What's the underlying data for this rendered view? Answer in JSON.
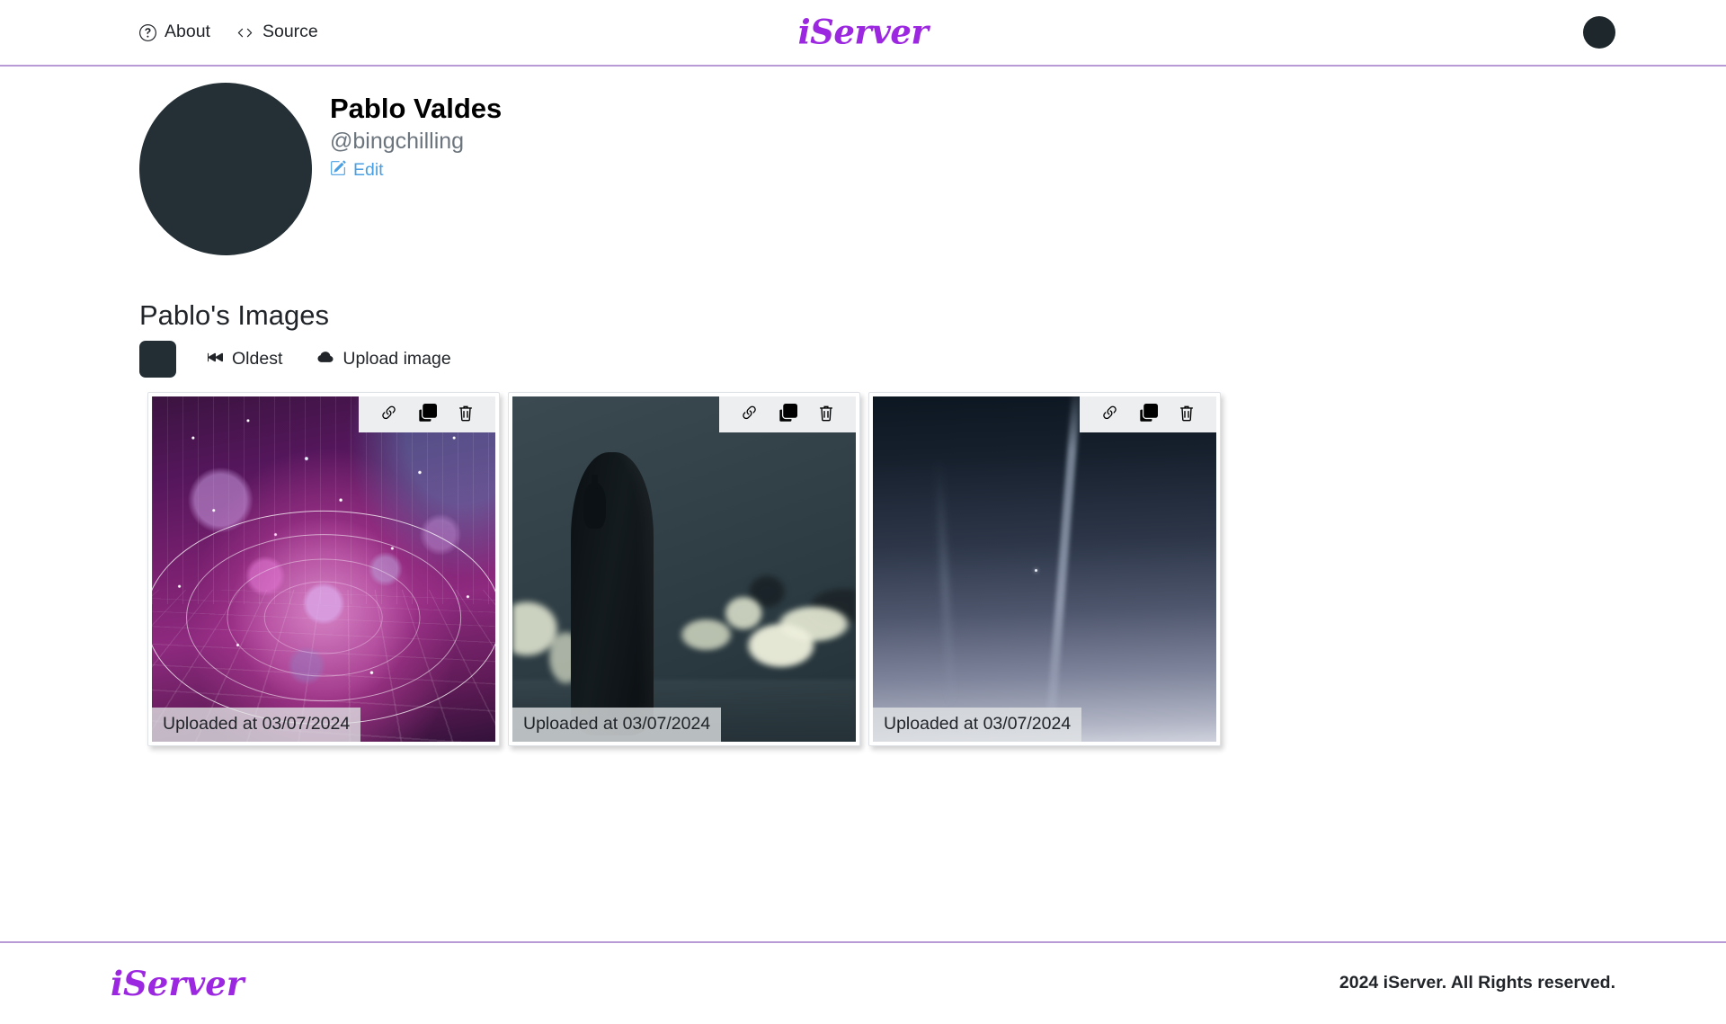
{
  "header": {
    "brand": "iServer",
    "nav": [
      {
        "label": "About",
        "icon": "question-circle-icon"
      },
      {
        "label": "Source",
        "icon": "code-icon"
      }
    ],
    "avatar_alt": "chess-avatar"
  },
  "profile": {
    "name": "Pablo Valdes",
    "handle": "@bingchilling",
    "edit_label": "Edit",
    "edit_icon": "pencil-square-icon",
    "edit_color": "#4a9fe2",
    "avatar_alt": "chess-profile-picture"
  },
  "gallery": {
    "title": "Pablo's Images",
    "toolbar": {
      "thumb_alt": "chess-thumbnail",
      "sort_label": "Oldest",
      "sort_icon": "skip-backward-icon",
      "upload_label": "Upload image",
      "upload_icon": "cloud-upload-icon"
    },
    "action_icons": {
      "link": "link-icon",
      "copy": "copy-icon",
      "delete": "trash-icon"
    },
    "items": [
      {
        "caption": "Uploaded at 03/07/2024",
        "art": "abstract-purple-geometry"
      },
      {
        "caption": "Uploaded at 03/07/2024",
        "art": "chess-king-fallen-pieces"
      },
      {
        "caption": "Uploaded at 03/07/2024",
        "art": "dark-gradient-sky-streak"
      }
    ]
  },
  "footer": {
    "brand": "iServer",
    "copyright": "2024 iServer. All Rights reserved."
  },
  "theme": {
    "accent": "#9c27e0",
    "border": "#b89ad6",
    "link": "#4a9fe2",
    "muted": "#6c757d"
  }
}
